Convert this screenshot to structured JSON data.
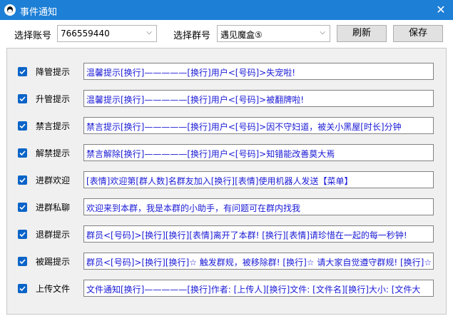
{
  "window": {
    "title": "事件通知",
    "close_glyph": "✕"
  },
  "toolbar": {
    "account_label": "选择账号",
    "account_value": "766559440",
    "group_label": "选择群号",
    "group_value": "遇见魔盒⑤",
    "refresh_label": "刷新",
    "save_label": "保存"
  },
  "rows": [
    {
      "label": "降管提示",
      "checked": true,
      "text": "温馨提示[换行]—————[换行]用户<[号码]>失宠啦!"
    },
    {
      "label": "升管提示",
      "checked": true,
      "text": "温馨提示[换行]—————[换行]用户<[号码]>被翻牌啦!"
    },
    {
      "label": "禁言提示",
      "checked": true,
      "text": "禁言提示[换行]—————[换行]用户<[号码]>因不守妇道，被关小黑屋[时长]分钟"
    },
    {
      "label": "解禁提示",
      "checked": true,
      "text": "禁言解除[换行]—————[换行]用户<[号码]>知错能改善莫大焉"
    },
    {
      "label": "进群欢迎",
      "checked": true,
      "text": "[表情]欢迎第[群人数]名群友加入[换行][表情]使用机器人发送【菜单】"
    },
    {
      "label": "进群私聊",
      "checked": true,
      "text": "欢迎来到本群，我是本群的小助手，有问题可在群内找我"
    },
    {
      "label": "退群提示",
      "checked": true,
      "text": "群员<[号码]>[换行][换行][表情]离开了本群! [换行][表情]请珍惜在一起的每一秒钟!"
    },
    {
      "label": "被踢提示",
      "checked": true,
      "text": "群员<[号码]>[换行][换行]☆ 触发群规，被移除群! [换行]☆ 请大家自觉遵守群规! [换行]☆ 按"
    },
    {
      "label": "上传文件",
      "checked": true,
      "text": "文件通知[换行]—————[换行]作者: [上传人][换行]文件: [文件名][换行]大小: [文件大"
    }
  ],
  "colors": {
    "titlebar": "#1d7fd6",
    "checkbox": "#0a64c8",
    "field_text": "#1a1ad6"
  }
}
